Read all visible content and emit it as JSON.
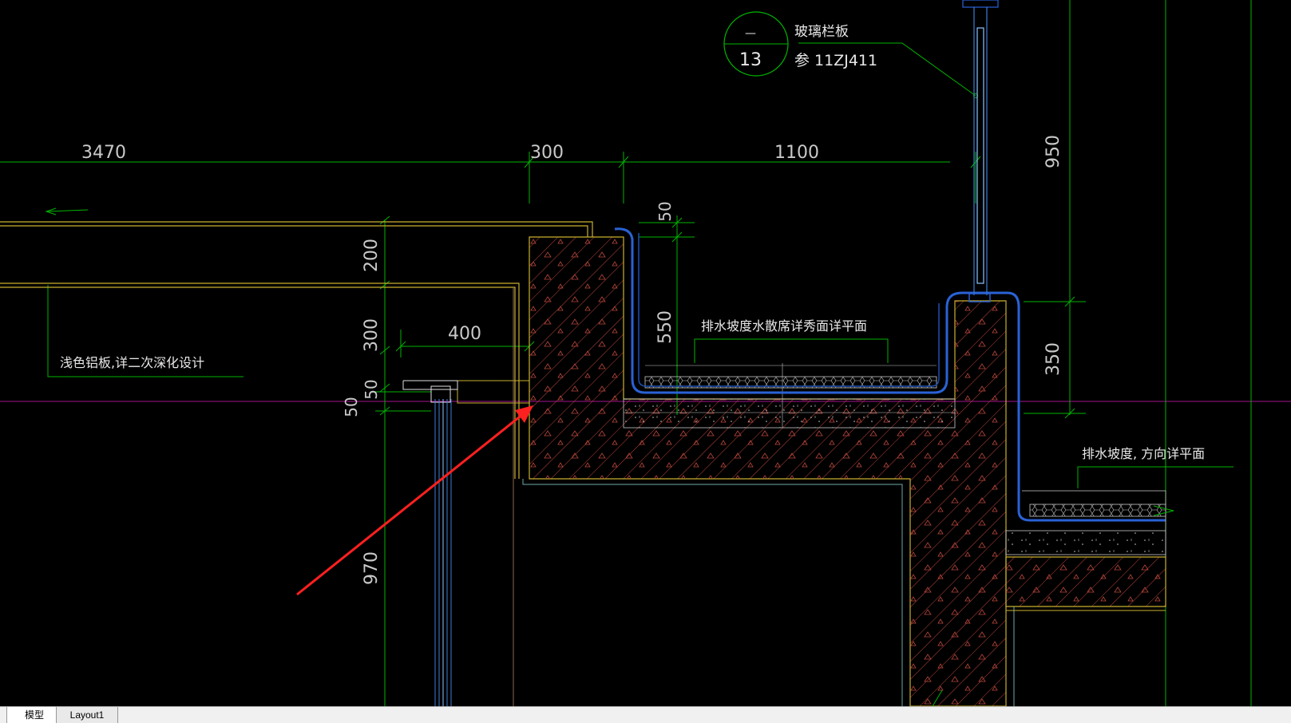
{
  "drawing": {
    "callout": {
      "top": "—",
      "bottom": "13"
    },
    "labels": {
      "glass_railing": "玻璃栏板",
      "ref_std": "参 11ZJ411",
      "aluminum_panel": "浅色铝板,详二次深化设计",
      "gutter_detail": "排水坡度水散席详秀面详平面",
      "drain_slope": "排水坡度, 方向详平面"
    },
    "dimensions": {
      "d3470": "3470",
      "d300_top": "300",
      "d1100": "1100",
      "d950": "950",
      "d50_top": "50",
      "d550": "550",
      "d200": "200",
      "d300_side": "300",
      "d400": "400",
      "d50_a": "50",
      "d50_b": "50",
      "d350": "350",
      "d970": "970"
    }
  },
  "tabs": {
    "model": "模型",
    "layout1": "Layout1"
  }
}
